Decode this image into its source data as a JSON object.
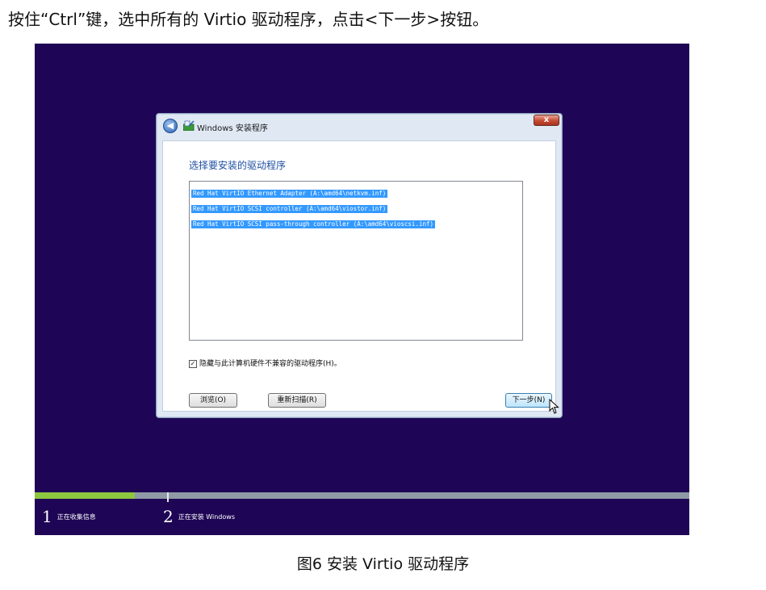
{
  "instruction": "按住“Ctrl”键，选中所有的 Virtio 驱动程序，点击<下一步>按钮。",
  "dialog": {
    "title": "Windows 安装程序",
    "close_symbol": "x",
    "heading": "选择要安装的驱动程序",
    "drivers": [
      "Red Hat VirtIO Ethernet Adapter (A:\\amd64\\netkvm.inf)",
      "Red Hat VirtIO SCSI controller (A:\\amd64\\viostor.inf)",
      "Red Hat VirtIO SCSI pass-through controller (A:\\amd64\\vioscsi.inf)"
    ],
    "hide_incompatible_checked": true,
    "checkbox_mark": "✓",
    "hide_incompatible_label": "隐藏与此计算机硬件不兼容的驱动程序(H)。",
    "browse_label": "浏览(O)",
    "rescan_label": "重新扫描(R)",
    "next_label": "下一步(N)"
  },
  "progress": {
    "fraction_step1": 0.153,
    "steps": [
      {
        "number": "1",
        "label": "正在收集信息"
      },
      {
        "number": "2",
        "label": "正在安装 Windows"
      }
    ]
  },
  "caption": "图6  安装 Virtio 驱动程序",
  "colors": {
    "background": "#1e0555",
    "progress_fill": "#8dc63f",
    "selection": "#3399ff",
    "heading": "#1e4fa1"
  }
}
